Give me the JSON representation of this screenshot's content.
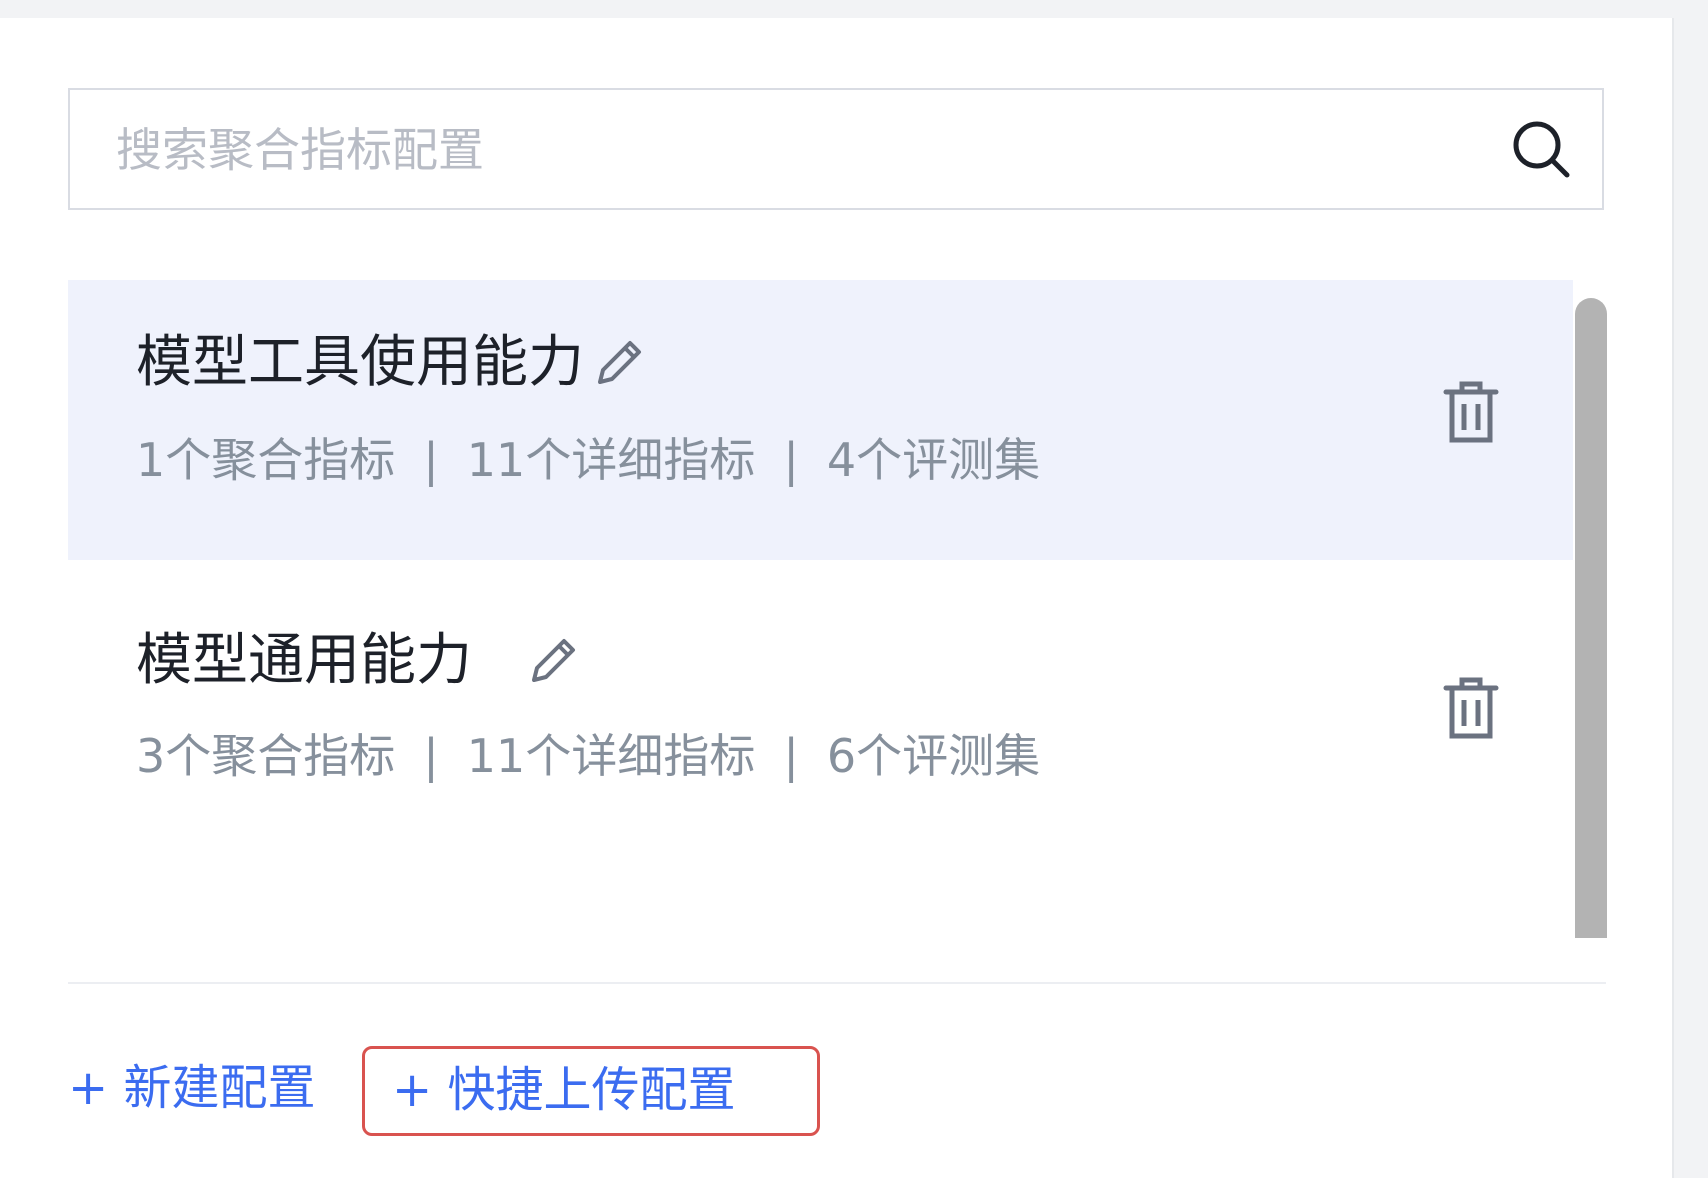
{
  "search": {
    "placeholder": "搜索聚合指标配置"
  },
  "items": [
    {
      "title": "模型工具使用能力",
      "stats": [
        "1个聚合指标",
        "11个详细指标",
        "4个评测集"
      ],
      "separator": "|",
      "selected": true
    },
    {
      "title": "模型通用能力",
      "stats": [
        "3个聚合指标",
        "11个详细指标",
        "6个评测集"
      ],
      "separator": "|",
      "selected": false
    }
  ],
  "footer": {
    "new_config": "+ 新建配置",
    "quick_upload": "+ 快捷上传配置"
  },
  "colors": {
    "accent": "#3b6cf0",
    "selected_bg": "#eff2fc",
    "highlight_border": "#d9534f"
  },
  "icons": [
    "search-icon",
    "edit-icon",
    "trash-icon"
  ]
}
